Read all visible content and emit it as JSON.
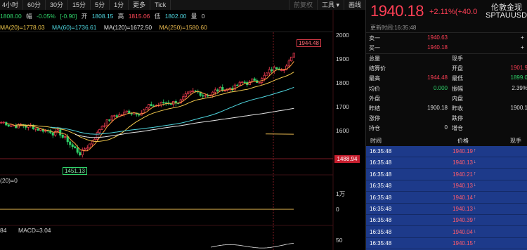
{
  "toolbar": {
    "periods": [
      "4小时",
      "60分",
      "30分",
      "15分",
      "5分",
      "1分",
      "更多",
      "Tick"
    ],
    "right": [
      "前复权",
      "工具 ▾",
      "画线"
    ]
  },
  "quote": {
    "open_prefix": "1808.00",
    "amp_label": "幅",
    "change": "-0.05%",
    "change_pts": "[-0.90]",
    "open_label": "开",
    "open": "1808.15",
    "high_label": "高",
    "high": "1815.06",
    "low_label": "低",
    "low": "1802.00",
    "qty_label": "量",
    "qty": "0"
  },
  "ma": {
    "ma20": "MA(20)=1778.03",
    "ma60": "MA(60)=1736.61",
    "ma120": "MA(120)=1672.50",
    "ma250": "MA(250)=1580.60"
  },
  "axis": {
    "y_labels": [
      "2000",
      "1900",
      "1800",
      "1700",
      "1600"
    ],
    "vol_labels": [
      "1万",
      "0"
    ],
    "macd_top": "50",
    "current_price_tag": "1488.94",
    "high_marker": "1944.48",
    "low_marker": "1451.13"
  },
  "indicators": {
    "vol_label": "(20)=0",
    "macd_label_a": "84",
    "macd_label_b": "MACD=3.04"
  },
  "panel": {
    "price": "1940.18",
    "change": "+2.11%(+40.0",
    "name": "伦敦金现",
    "code": "SPTAUUSDO",
    "updated": "更新时间:16:35:48",
    "sell_label": "卖一",
    "sell_price": "1940.63",
    "buy_label": "买一",
    "buy_price": "1940.18",
    "stats": [
      {
        "l1": "总量",
        "v1": "",
        "l2": "现手",
        "v2": ""
      },
      {
        "l1": "结算价",
        "v1": "",
        "l2": "开盘",
        "v2": "1901.9"
      },
      {
        "l1": "最高",
        "v1": "1944.48",
        "l2": "最低",
        "v2": "1899.0"
      },
      {
        "l1": "均价",
        "v1": "0.000",
        "l2": "振幅",
        "v2": "2.39%"
      },
      {
        "l1": "外盘",
        "v1": "",
        "l2": "内盘",
        "v2": ""
      },
      {
        "l1": "昨结",
        "v1": "1900.18",
        "l2": "昨收",
        "v2": "1900.1"
      },
      {
        "l1": "涨停",
        "v1": "",
        "l2": "跌停",
        "v2": ""
      },
      {
        "l1": "持仓",
        "v1": "0",
        "l2": "增仓",
        "v2": ""
      }
    ],
    "tick_headers": {
      "time": "时间",
      "price": "价格",
      "hand": "现手"
    },
    "ticks": [
      {
        "time": "16:35:48",
        "price": "1940.19",
        "arrow": "↑"
      },
      {
        "time": "16:35:48",
        "price": "1940.13",
        "arrow": "↓"
      },
      {
        "time": "16:35:48",
        "price": "1940.21",
        "arrow": "↑"
      },
      {
        "time": "16:35:48",
        "price": "1940.13",
        "arrow": "↓"
      },
      {
        "time": "16:35:48",
        "price": "1940.14",
        "arrow": "↑"
      },
      {
        "time": "16:35:48",
        "price": "1940.13",
        "arrow": "↓"
      },
      {
        "time": "16:35:48",
        "price": "1940.39",
        "arrow": "↑"
      },
      {
        "time": "16:35:48",
        "price": "1940.04",
        "arrow": "↓"
      },
      {
        "time": "16:35:48",
        "price": "1940.15",
        "arrow": "↑"
      }
    ]
  },
  "colors": {
    "up": "#ff3f55",
    "down": "#2fd36a",
    "ma20": "#f2c94c",
    "ma60": "#4fd7e0",
    "ma120": "#e6e6e6",
    "ma250": "#e8b84f",
    "tick_bg": "#1d3a8a"
  },
  "chart_data": {
    "type": "candlestick",
    "ylim": [
      1440,
      2030
    ],
    "y_ticks": [
      2000,
      1900,
      1800,
      1700,
      1600
    ],
    "high": 1944.48,
    "low": 1451.13,
    "last_close": 1940.18,
    "ma20_last": 1778.03,
    "ma60_last": 1736.61,
    "ma120_last": 1672.5,
    "ma250_last": 1580.6
  }
}
